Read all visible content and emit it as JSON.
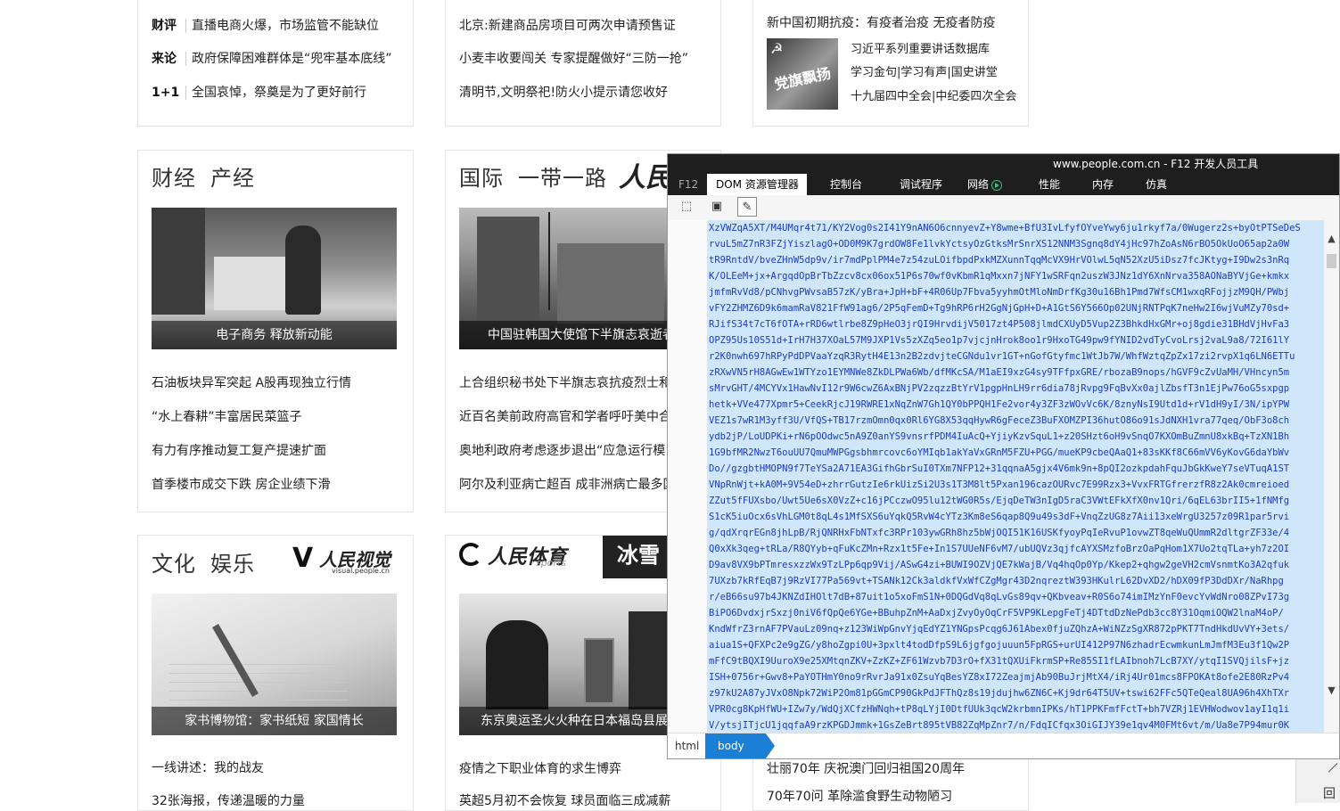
{
  "top_left": {
    "rows": [
      {
        "tag": "财评",
        "text": "直播电商火爆，市场监管不能缺位"
      },
      {
        "tag": "来论",
        "text": "政府保障困难群体是“兜牢基本底线”"
      },
      {
        "tag": "1+1",
        "text": "全国哀悼，祭奠是为了更好前行"
      }
    ]
  },
  "top_mid": {
    "items": [
      "北京:新建商品房项目可两次申请预售证",
      "小麦丰收要闯关  专家提醒做好“三防一抢”",
      "清明节,文明祭祀!防火小提示请您收好"
    ]
  },
  "top_right": {
    "header": "新中国初期抗疫：有疫者治疫 无疫者防疫",
    "thumb_text": "党旗飘扬",
    "links": [
      "习近平系列重要讲话数据库",
      "学习金句|学习有声|国史讲堂",
      "十九届四中全会|中纪委四次全会"
    ]
  },
  "section_finance": {
    "title_a": "财经",
    "title_b": "产经",
    "photo_caption": "电子商务 释放新动能",
    "items": [
      "石油板块异军突起 A股再现独立行情",
      "“水上春耕”丰富居民菜篮子",
      "有力有序推动复工复产提速扩面",
      "首季楼市成交下跌 房企业绩下滑"
    ]
  },
  "section_intl": {
    "title_a": "国际",
    "title_b": "一带一路",
    "logo": "人民",
    "photo_caption": "中国驻韩国大使馆下半旗志哀逝者",
    "items": [
      "上合组织秘书处下半旗志哀抗疫烈士和",
      "近百名美前政府高官和学者呼吁美中合作",
      "奥地利政府考虑逐步退出“应急运行模",
      "阿尔及利亚病亡超百 成非洲病亡最多国"
    ]
  },
  "section_culture": {
    "title_a": "文化",
    "title_b": "娱乐",
    "logo": "人民视觉",
    "logo_sub": "visual.people.cn",
    "photo_caption": "家书博物馆：家书纸短 家国情长",
    "items": [
      "一线讲述：我的战友",
      "32张海报，传递温暖的力量"
    ]
  },
  "section_sports": {
    "logo": "人民体育",
    "logo_sub": "sports",
    "logo2": "冰雪",
    "photo_caption": "东京奥运圣火火种在日本福岛县展出",
    "items": [
      "疫情之下职业体育的求生博弈",
      "英超5月初不会恢复 球员面临三成减薪"
    ]
  },
  "section_right_bottom": {
    "items": [
      "壮丽70年 庆祝澳门回归祖国20周年",
      "70年70问 革除滥食野生动物陋习"
    ]
  },
  "devtools": {
    "window_title": "www.people.com.cn - F12 开发人员工具",
    "tabs": [
      "F12",
      "DOM 资源管理器",
      "控制台",
      "调试程序",
      "网络",
      "性能",
      "内存",
      "仿真"
    ],
    "active_tab": "DOM 资源管理器",
    "breadcrumb": [
      "html",
      "body"
    ],
    "code_lines": [
      "XzVWZqA5XT/M4UMqr4t71/KY2Vog0s2I41Y9nAN6O6cnnyevZ+Y8wme+BfU3IvLfyfOYveYwy6ju1rkyf7a/0Wugerz2s+byOtPTSeDeS",
      "rvuL5mZ7nR3FZjYiszlagO+OD0M9K7grdOW8Fe1lvkYctsyOzGtksMrSnrXS12NNM3Sgnq8dY4jHc97hZoAsN6rBO5OkUoO65ap2a0W",
      "tR9RntdV/bveZHnW5dp9v/ir7mdPplPM4e7z54zuLOifbpdPxkMZXunnTqqMcVX9HrVOlwL5qN52XzU5iDsz7fcJKtyg+I9Dw2s3nRq",
      "K/OLEeM+jx+ArgqdOpBrTbZzcv8cx06ox51P6s70wf0vKbmR1qMxxn7jNFY1wSRFqn2uszW3JNz1dY6XnNrva358AONaBYVjGe+kmkx",
      "jmfmRvVd8/pCNhvgPWvsaB57zK/yBra+JpH+bF+4R06Up7Fbva5yyhmOtMloNmDrfKg30u16Bh1Pmd7WfsCM1wxqRFojjzM9QH/PWbj",
      "vFY2ZHMZ6D9k6mamRaV821FfW91ag6/2P5qFemD+Tg9hRP6rH2GgNjGpH+D+A1GtS6Y566Op02UNjRNTPqK7neHw2I6wjVuMZy70sd+",
      "RJifS34t7cT6fOTA+rRD6wtlrbe8Z9pHeO3jrQI9HrvdijV5017zt4P508jlmdCXUyD5Vup2Z3BhkdHxGMr+oj8gdie31BHdVjHvFa3",
      "OPZ95Us10S51d+IrH7H37XOaL57M9JXP1Vs5zXZq5eo1p7vjcjnHrok8oo1r9HxoTG49pw9fYNID2vdTyCvoLrsj2vaL9a8/72I61lY",
      "r2K0nwh697hRPyPdDPVaaYzqR3RytH4E13n2B2zdvjteCGNdu1vr1GT+nGofGtyfmc1WtJb7W/WhfWztqZpZx17zi2rvpX1q6LN6ETTu",
      "zRXwVN5rH8AGwEw1WTYzo1EYMNWe8ZkDLPWa6Wb/dfMKcSA/M1aEI9xzG4sy9TFfpxGRE/rbozaB9nops/hGVF9cZvUaMH/VHncyn5m",
      "sMrvGHT/4MCYVx1HawNvI12r9W6cwZ6AxBNjPV2zqzzBtYrV1pgpHnLH9rr6dia78jRvpg9FqBvXx0ajlZbsfT3n1EjPw76oG5sxpgp",
      "hetk+VVe477Xpmr5+CeekRjcJ19RWRE1xNqZnW7Gh1QY0bPPQH1Fe2vor4y3ZF3zWOvVc6K/8znyNsI9Utd1d+rV1dH9yI/3N/ipYPW",
      "VEZ1s7wR1M3yff3U/VfQS+TB17rzmOmn0qx0Rl6YG8X53qqHywR6gFeceZ3BuFXOMZPI36hutO86o91sJdNXH1vra77qeq/ObF3o8ch",
      "ydb2jP/LoUDPKi+rN6pOOdwc5nA9Z0anYS9vnsrfPDM4IuAcQ+YjiyKzvSquL1+z20SHzt6oH9vSnqO7KXOmBuZmnU8xkBq+TzXN1Bh",
      "1G9bfMR2NwzT6ouUU7QmuMWPGgsbhmrcovc6oYMIqb1akYaVxGRnM5FZU+PGG/mueKP9cbeQAaQ1+83sKKf8C66mVV6yKovG6daYbWv",
      "Do//gzgbtHMOPN9f7TeYSa2A71EA3GifhGbrSuI0TXm7NFP12+31qqnaA5gjx4V6mk9n+8pQI2ozkpdahFquJbGkKweY7seVTuqA1ST",
      "VNpRnWjt+kA0M+9V54eD+zhrrGutzIe6rkUizSi2U3s1T3M8lt5Pxan196cazOURvc7E99Rzx3+VvxFRTGfrerzfR8z2Ak0cmreioed",
      "ZZut5fFUXsbo/Uwt5Ue6sX0VzZ+c16jPCczwO95lu12tWG0R5s/EjqDeTW3nIgD5raC3VWtEFkXfX0nv1Qri/6qEL63brII5+1fNMfg",
      "S1cK5iuOcx6sVhLGM0t8qL4s1MfSXS6uYqkQ5RvW4cYTz3Km8eS6qap8Q9u49s3dF+VnqZzUG8z7Aii13xeWrgU3257z09R1par5rvi",
      "g/qdXrqrEGn8jhLpB/RjQNRHxFbNTxfc3RPr103ywGRh8hz5bWjOQI51K16USKfyoyPqIeRvuP1ovwZT8qeWuQUmmR2dltgrZF33e/4",
      "Q0xXk3qeg+tRLa/R8QYyb+qFuKcZMn+Rzx1t5Fe+In1S7UUeNF6vM7/ubUQVz3qjfcAYXSMzfoBrzOaPqHom1X7Uo2tqTLa+yh7z2OI",
      "D9av8VX9bPTmresxzzWx9TzLPp6qp9Vij/ASwG4zi+BUWI9OZVjQE7kWajB/Vq4hqOp0Yp/Kkep2+qhgw2geVH2cmVsnmtKo3A2qfuk",
      "7UXzb7kRfEqB7j9RzVI77Pa569vt+TSANk12Ck3aldkfVxWfCZgMgr43D2nqreztW393HKulrL62DvXD2/hDX09fP3DdDXr/NaRhpg",
      "r/eB66su97b4JKNZdIHOlt7dB+87uit1o5xoFmS1N+0DQGdVq8qLvGs89qv+QKbveav+R0S6o74imIMzYnF0evcYvWdNro08ZPvI73g",
      "BiPO6DvdxjrSxzj0niV6fQpQe6YGe+BBuhpZnM+AaDxjZvyOyOqCrF5VP9KLepgFeTj4DTtdDzNePdb3cc8Y31OqmiOQW2lnaM4oP/",
      "KndWfrZ3rnAF7PVauLz09nq+z123WiWpGnvYjqEdYZ1YNGpsPcqg6J61Abex0fjuZQhzA+WiNZzSgXR872pPKT7TndHkdUvVY+3ets/",
      "aiua1S+QFXPc2e9gZG/y8hoZgpi0U+3pxlt4todDfpS9L6jgfgojuuun5FpRGS+urUI412P97N6zhadrEcwmkunLmJmfM3Eu3f1Qw2P",
      "mFfC9tBQXI9UuroX9e25XMtqnZKV+ZzKZ+ZF61Wzvb7D3rO+fX31tQXUiFkrmSP+Re85SI1fLAIbnoh7LcB7XY/ytqI1SVQjilsF+jz",
      "ISH+0756r+Gwv8+PaYOTHmY0no9rRvrJa91x0ZsuYqBesYZ8xI72ZeajmjAb90BuJrjMtX4/iRj4Ur01mcs8FPOKAt8ofe2E80RzPv4",
      "z97kU2A87yJVxO8Npk72WiP2Om81pGGmCP90GkPdJFThQz8s19jdujhw6ZN6C+Kj9dr64T5UV+tswi62FFc5QTeQeal8UA96h4XhTXr",
      "VPR0cg8KpHfWU+IZw7y/WdQjXCfzHWNqh+tP8qLYjI0DtfUUk3qcW2krbmnIPKs/hT1PPKFmfFctT+bh7VZRj1EVHWodwov1ayI1q1i",
      "V/ytsjITjcU1jqqfaA9rzKPGDJmmk+1GsZeBrt895tVB82ZqMpZnr7/n/FdqICfqx3OiGIJY39e1qv4M0FMt6vt/m/Ua8e7P94mur0K"
    ]
  },
  "corner": {
    "label": "回"
  }
}
